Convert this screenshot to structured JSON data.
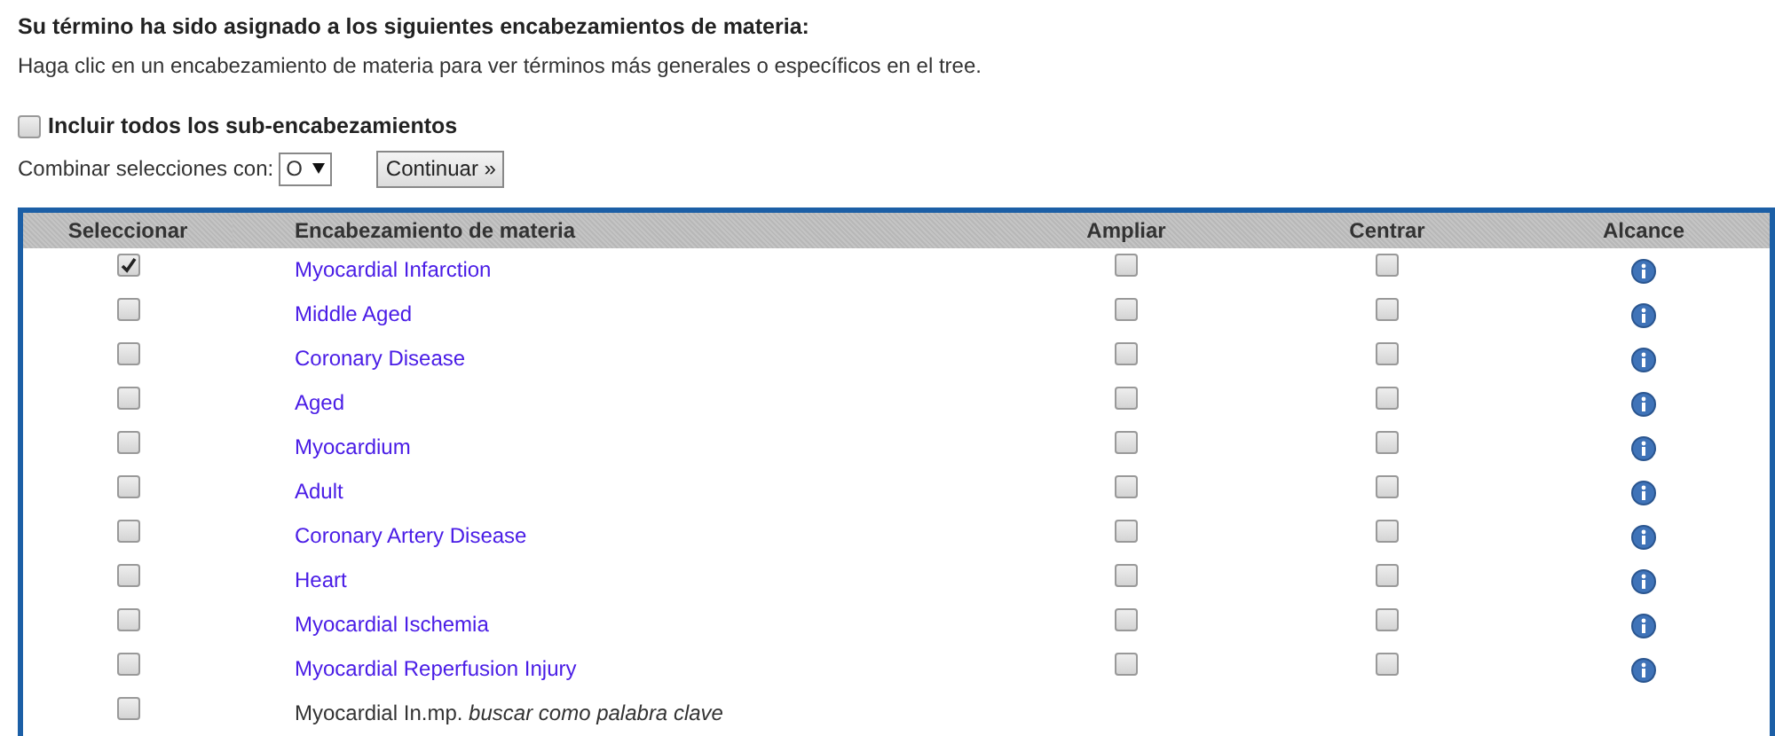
{
  "heading": "Su término ha sido asignado a los siguientes encabezamientos de materia:",
  "instructions": "Haga clic en un encabezamiento de materia para ver términos más generales o específicos en el tree.",
  "include_all": {
    "label": "Incluir todos los sub-encabezamientos",
    "checked": false
  },
  "combine": {
    "label": "Combinar selecciones con:",
    "value": "O"
  },
  "continue_button": "Continuar »",
  "table": {
    "columns": [
      "Seleccionar",
      "Encabezamiento de materia",
      "Ampliar",
      "Centrar",
      "Alcance"
    ],
    "rows": [
      {
        "kind": "heading",
        "subject": "Myocardial Infarction",
        "selected": true,
        "explode": false,
        "focus": false
      },
      {
        "kind": "heading",
        "subject": "Middle Aged",
        "selected": false,
        "explode": false,
        "focus": false
      },
      {
        "kind": "heading",
        "subject": "Coronary Disease",
        "selected": false,
        "explode": false,
        "focus": false
      },
      {
        "kind": "heading",
        "subject": "Aged",
        "selected": false,
        "explode": false,
        "focus": false
      },
      {
        "kind": "heading",
        "subject": "Myocardium",
        "selected": false,
        "explode": false,
        "focus": false
      },
      {
        "kind": "heading",
        "subject": "Adult",
        "selected": false,
        "explode": false,
        "focus": false
      },
      {
        "kind": "heading",
        "subject": "Coronary Artery Disease",
        "selected": false,
        "explode": false,
        "focus": false
      },
      {
        "kind": "heading",
        "subject": "Heart",
        "selected": false,
        "explode": false,
        "focus": false
      },
      {
        "kind": "heading",
        "subject": "Myocardial Ischemia",
        "selected": false,
        "explode": false,
        "focus": false
      },
      {
        "kind": "heading",
        "subject": "Myocardial Reperfusion Injury",
        "selected": false,
        "explode": false,
        "focus": false
      },
      {
        "kind": "keyword",
        "subject": "Myocardial In.mp. *buscar como palabra clave*",
        "selected": false
      }
    ]
  }
}
